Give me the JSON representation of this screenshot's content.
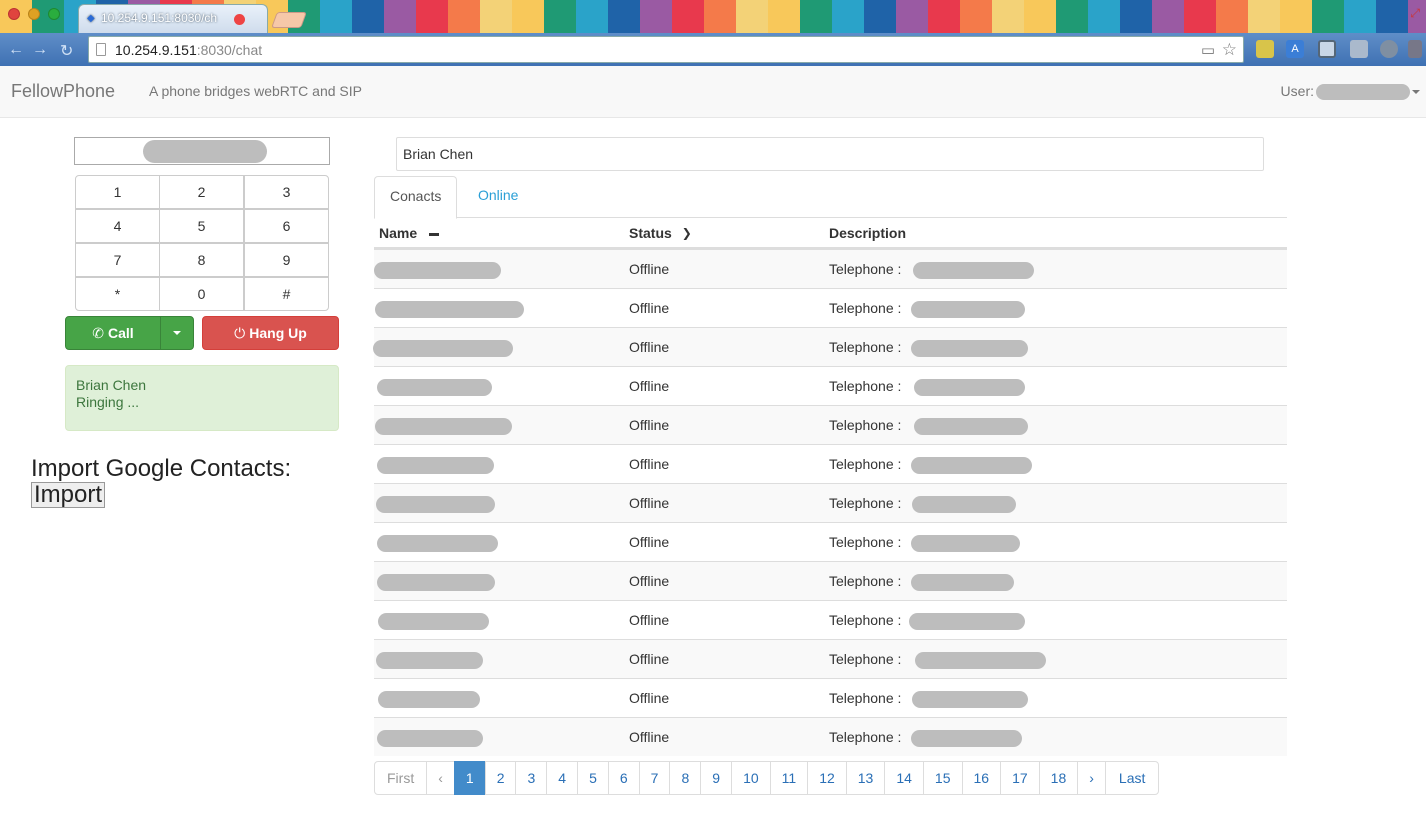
{
  "browser": {
    "tab_title": "10.254.9.151:8030/ch",
    "url_host": "10.254.9.151",
    "url_rest": ":8030/chat",
    "ext2_label": "A"
  },
  "navbar": {
    "brand": "FellowPhone",
    "tagline": "A phone bridges webRTC and SIP",
    "user_label": "User:"
  },
  "dialer": {
    "keys": [
      "1",
      "2",
      "3",
      "4",
      "5",
      "6",
      "7",
      "8",
      "9",
      "*",
      "0",
      "#"
    ],
    "call_label": "Call",
    "hangup_label": "Hang Up",
    "call_icon": "✆",
    "hangup_icon": "⏻"
  },
  "status": {
    "line1": "Brian Chen",
    "line2": "Ringing ..."
  },
  "import": {
    "title": "Import Google Contacts:",
    "button": "Import"
  },
  "contacts": {
    "search_value": "Brian Chen",
    "tabs": [
      "Conacts",
      "Online"
    ],
    "headers": {
      "name": "Name",
      "status": "Status",
      "description": "Description"
    },
    "rows": [
      {
        "status": "Offline",
        "desc": "Telephone :"
      },
      {
        "status": "Offline",
        "desc": "Telephone :"
      },
      {
        "status": "Offline",
        "desc": "Telephone :"
      },
      {
        "status": "Offline",
        "desc": "Telephone :"
      },
      {
        "status": "Offline",
        "desc": "Telephone :"
      },
      {
        "status": "Offline",
        "desc": "Telephone :"
      },
      {
        "status": "Offline",
        "desc": "Telephone :"
      },
      {
        "status": "Offline",
        "desc": "Telephone :"
      },
      {
        "status": "Offline",
        "desc": "Telephone :"
      },
      {
        "status": "Offline",
        "desc": "Telephone :"
      },
      {
        "status": "Offline",
        "desc": "Telephone :"
      },
      {
        "status": "Offline",
        "desc": "Telephone :"
      },
      {
        "status": "Offline",
        "desc": "Telephone :"
      }
    ]
  },
  "pagination": {
    "first": "First",
    "prev": "‹",
    "pages": [
      "1",
      "2",
      "3",
      "4",
      "5",
      "6",
      "7",
      "8",
      "9",
      "10",
      "11",
      "12",
      "13",
      "14",
      "15",
      "16",
      "17",
      "18"
    ],
    "active": "1",
    "next": "›",
    "last": "Last"
  }
}
